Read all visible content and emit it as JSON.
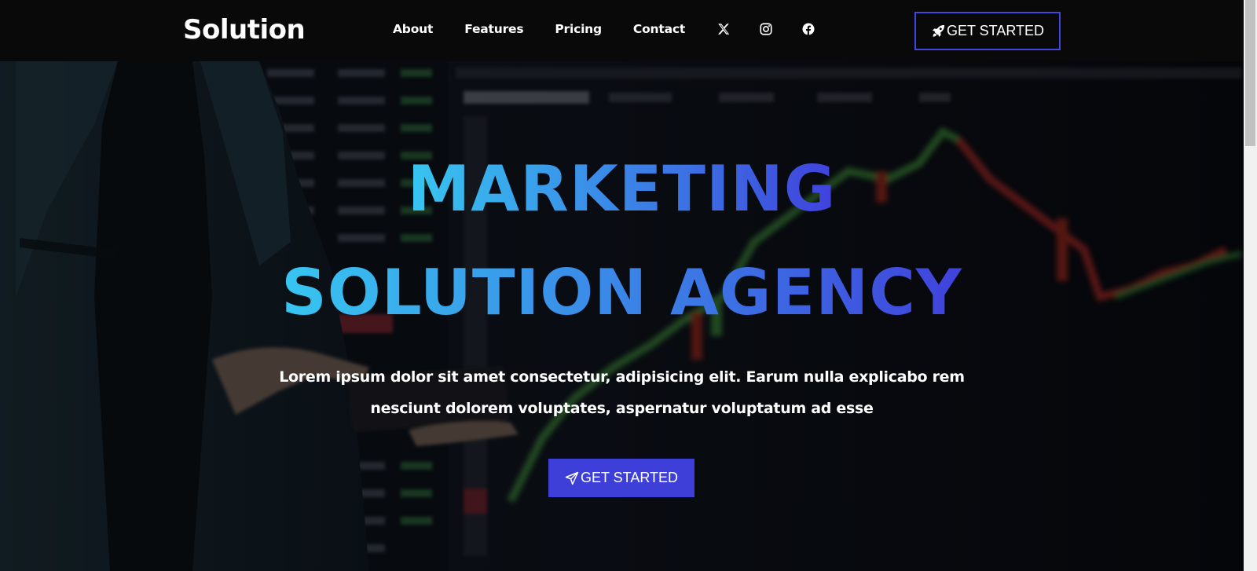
{
  "navbar": {
    "brand": "Solution",
    "links": [
      {
        "label": "About"
      },
      {
        "label": "Features"
      },
      {
        "label": "Pricing"
      },
      {
        "label": "Contact"
      }
    ],
    "social_icons": [
      "x-twitter-icon",
      "instagram-icon",
      "facebook-icon"
    ],
    "cta": {
      "label": "GET STARTED",
      "icon": "rocket-icon"
    }
  },
  "hero": {
    "headline_line1": "MARKETING",
    "headline_line2": "SOLUTION AGENCY",
    "lead": "Lorem ipsum dolor sit amet consectetur, adipisicing elit. Earum nulla explicabo rem nesciunt dolorem voluptates, aspernatur voluptatum ad esse",
    "cta": {
      "label": "GET STARTED",
      "icon": "paper-plane-icon"
    }
  },
  "colors": {
    "navbar_bg": "#090909",
    "accent": "#3e3fd9",
    "gradient_start": "#37c6f0",
    "gradient_end": "#4042dc"
  }
}
